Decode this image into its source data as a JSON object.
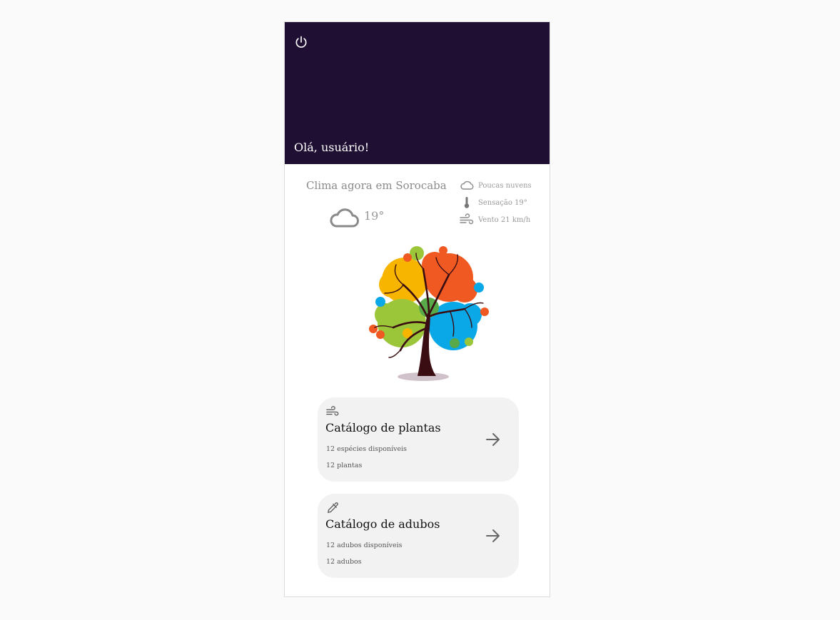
{
  "header": {
    "greeting": "Olá, usuário!",
    "power_icon": "power-icon",
    "background": "#1f1033"
  },
  "weather": {
    "title": "Clima agora em Sorocaba",
    "temperature": "19°",
    "condition_icon": "cloud-icon",
    "details": [
      {
        "icon": "cloud-icon",
        "text": "Poucas nuvens"
      },
      {
        "icon": "thermometer-icon",
        "text": "Sensação 19°"
      },
      {
        "icon": "wind-icon",
        "text": "Vento 21 km/h"
      }
    ]
  },
  "illustration": {
    "name": "colorful-tree"
  },
  "cards": [
    {
      "icon": "wind-icon",
      "title": "Catálogo de plantas",
      "line1": "12 espécies disponíveis",
      "line2": "12 plantas"
    },
    {
      "icon": "eyedropper-icon",
      "title": "Catálogo de adubos",
      "line1": "12 adubos disponíveis",
      "line2": "12 adubos"
    }
  ]
}
